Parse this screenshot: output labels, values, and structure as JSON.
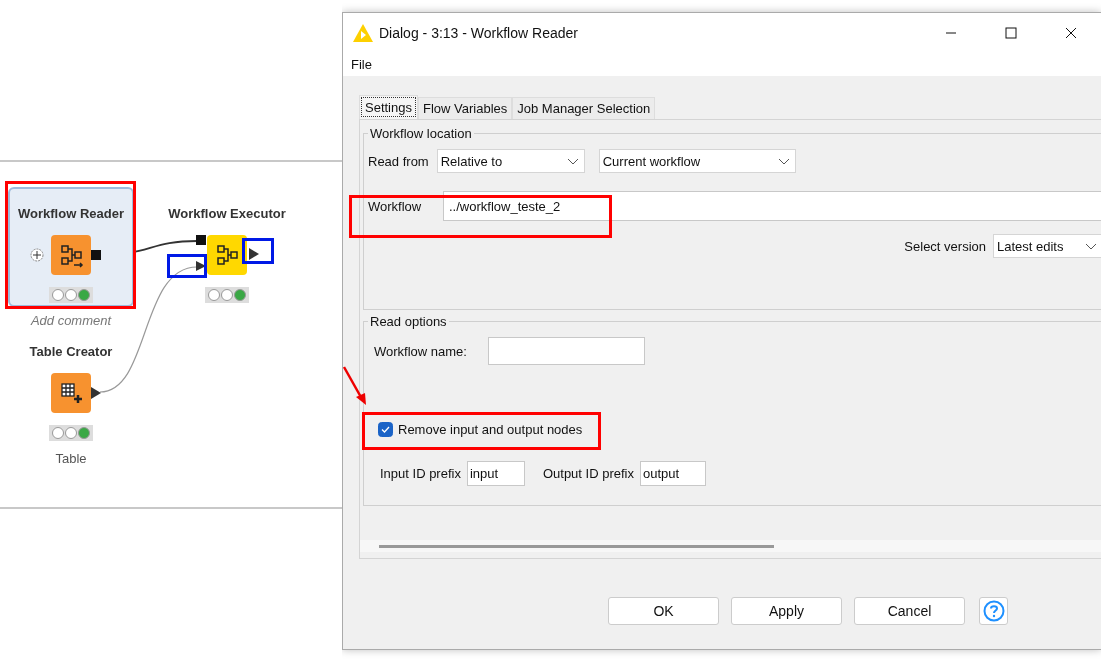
{
  "canvas": {
    "nodes": [
      {
        "kind": "reader",
        "name": "Workflow Reader",
        "selected": true,
        "executed": true,
        "comment": "Add comment"
      },
      {
        "kind": "executor",
        "name": "Workflow Executor",
        "selected": false,
        "executed": true
      },
      {
        "kind": "creator",
        "name": "Table Creator",
        "selected": false,
        "executed": true,
        "comment": "Table"
      }
    ]
  },
  "dialog": {
    "title": "Dialog - 3:13 - Workflow Reader",
    "menu": [
      "File"
    ],
    "tabs": [
      {
        "label": "Settings",
        "selected": true
      },
      {
        "label": "Flow Variables",
        "selected": false
      },
      {
        "label": "Job Manager Selection",
        "selected": false
      }
    ],
    "workflow_location": {
      "title": "Workflow location",
      "read_from_label": "Read from",
      "read_from": "Relative to",
      "relative_to": "Current workflow",
      "workflow_label": "Workflow",
      "workflow": "../workflow_teste_2",
      "version_label": "Select version",
      "version": "Latest edits"
    },
    "read_options": {
      "title": "Read options",
      "name_label": "Workflow name:",
      "remove_io": {
        "label": "Remove input and output nodes",
        "checked": true
      },
      "input_prefix_label": "Input ID prefix",
      "input_prefix": "input",
      "output_prefix_label": "Output ID prefix",
      "output_prefix": "output"
    },
    "buttons": [
      "OK",
      "Apply",
      "Cancel"
    ]
  }
}
